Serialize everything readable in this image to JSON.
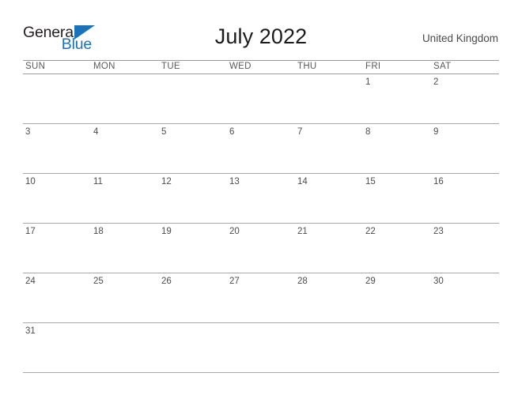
{
  "brand": {
    "name_part1": "General",
    "name_part2": "Blue",
    "logo_icon": "triangle-icon",
    "color_dark": "#231f20",
    "color_blue": "#1b72b8"
  },
  "header": {
    "title": "July 2022",
    "country": "United Kingdom"
  },
  "calendar": {
    "month": "July",
    "year": "2022",
    "first_day_of_week": "SUN",
    "day_headers": [
      "SUN",
      "MON",
      "TUE",
      "WED",
      "THU",
      "FRI",
      "SAT"
    ],
    "weeks": [
      [
        {
          "day": ""
        },
        {
          "day": ""
        },
        {
          "day": ""
        },
        {
          "day": ""
        },
        {
          "day": ""
        },
        {
          "day": "1"
        },
        {
          "day": "2"
        }
      ],
      [
        {
          "day": "3"
        },
        {
          "day": "4"
        },
        {
          "day": "5"
        },
        {
          "day": "6"
        },
        {
          "day": "7"
        },
        {
          "day": "8"
        },
        {
          "day": "9"
        }
      ],
      [
        {
          "day": "10"
        },
        {
          "day": "11"
        },
        {
          "day": "12"
        },
        {
          "day": "13"
        },
        {
          "day": "14"
        },
        {
          "day": "15"
        },
        {
          "day": "16"
        }
      ],
      [
        {
          "day": "17"
        },
        {
          "day": "18"
        },
        {
          "day": "19"
        },
        {
          "day": "20"
        },
        {
          "day": "21"
        },
        {
          "day": "22"
        },
        {
          "day": "23"
        }
      ],
      [
        {
          "day": "24"
        },
        {
          "day": "25"
        },
        {
          "day": "26"
        },
        {
          "day": "27"
        },
        {
          "day": "28"
        },
        {
          "day": "29"
        },
        {
          "day": "30"
        }
      ],
      [
        {
          "day": "31"
        },
        {
          "day": ""
        },
        {
          "day": ""
        },
        {
          "day": ""
        },
        {
          "day": ""
        },
        {
          "day": ""
        },
        {
          "day": ""
        }
      ]
    ]
  },
  "colors": {
    "rule": "#9b9b9b",
    "text": "#4d4d4d",
    "title": "#1b1b1b",
    "background": "#ffffff"
  }
}
